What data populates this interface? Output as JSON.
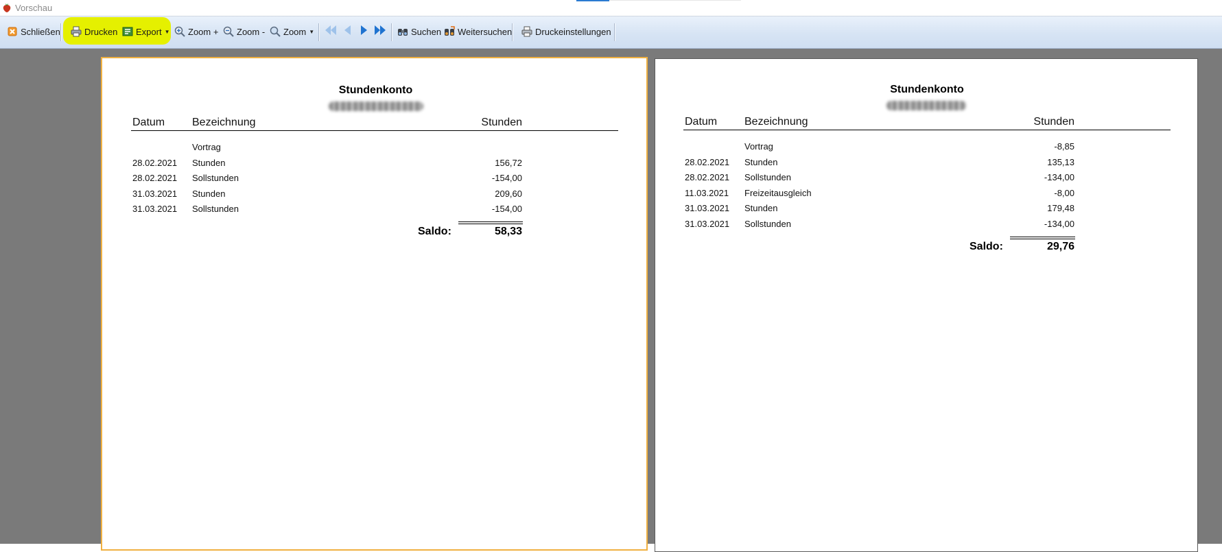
{
  "window": {
    "title": "Vorschau"
  },
  "toolbar": {
    "close_label": "Schließen",
    "print_label": "Drucken",
    "export_label": "Export",
    "zoom_in_label": "Zoom +",
    "zoom_out_label": "Zoom -",
    "zoom_label": "Zoom",
    "search_label": "Suchen",
    "search_next_label": "Weitersuchen",
    "print_settings_label": "Druckeinstellungen",
    "highlight_color": "#e5f000"
  },
  "colors": {
    "accent": "#2b7bd1",
    "preview_background": "#7a7a7a",
    "selected_page_border": "#f0b040"
  },
  "pages": [
    {
      "title": "Stundenkonto",
      "headers": {
        "date": "Datum",
        "description": "Bezeichnung",
        "hours": "Stunden"
      },
      "rows": [
        {
          "date": "",
          "description": "Vortrag",
          "hours": ""
        },
        {
          "date": "28.02.2021",
          "description": "Stunden",
          "hours": "156,72"
        },
        {
          "date": "28.02.2021",
          "description": "Sollstunden",
          "hours": "-154,00"
        },
        {
          "date": "31.03.2021",
          "description": "Stunden",
          "hours": "209,60"
        },
        {
          "date": "31.03.2021",
          "description": "Sollstunden",
          "hours": "-154,00"
        }
      ],
      "saldo_label": "Saldo:",
      "saldo_value": "58,33"
    },
    {
      "title": "Stundenkonto",
      "headers": {
        "date": "Datum",
        "description": "Bezeichnung",
        "hours": "Stunden"
      },
      "rows": [
        {
          "date": "",
          "description": "Vortrag",
          "hours": "-8,85"
        },
        {
          "date": "28.02.2021",
          "description": "Stunden",
          "hours": "135,13"
        },
        {
          "date": "28.02.2021",
          "description": "Sollstunden",
          "hours": "-134,00"
        },
        {
          "date": "11.03.2021",
          "description": "Freizeitausgleich",
          "hours": "-8,00"
        },
        {
          "date": "31.03.2021",
          "description": "Stunden",
          "hours": "179,48"
        },
        {
          "date": "31.03.2021",
          "description": "Sollstunden",
          "hours": "-134,00"
        }
      ],
      "saldo_label": "Saldo:",
      "saldo_value": "29,76"
    }
  ]
}
